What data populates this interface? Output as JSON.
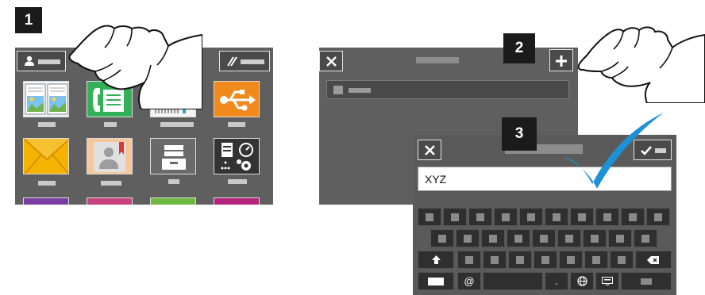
{
  "steps": {
    "one": "1",
    "two": "2",
    "three": "3"
  },
  "keyboard_dialog": {
    "input_value": "XYZ"
  },
  "keyboard": {
    "at_key": "@",
    "period_key": "."
  },
  "icons": {
    "grid": [
      "scan-to-book-icon",
      "fax-icon",
      "copy-id-card-icon",
      "usb-icon",
      "email-icon",
      "address-book-icon",
      "stored-jobs-icon",
      "apps-settings-icon"
    ]
  },
  "colors": {
    "panel": "#5f5f5f",
    "checkmark": "#1e90d6",
    "usb_tile": "#f08a1c",
    "email_tile": "#f5b400",
    "fax_tile": "#35b05a"
  }
}
